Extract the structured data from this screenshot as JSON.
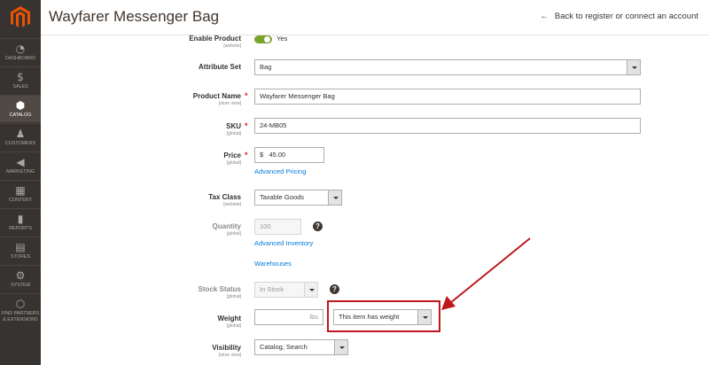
{
  "header": {
    "title": "Wayfarer Messenger Bag",
    "back_label": "Back to register or connect an account"
  },
  "sidebar": {
    "items": [
      {
        "icon": "dashboard-icon",
        "label": "DASHBOARD"
      },
      {
        "icon": "dollar-icon",
        "label": "SALES"
      },
      {
        "icon": "catalog-box-icon",
        "label": "CATALOG"
      },
      {
        "icon": "person-icon",
        "label": "CUSTOMERS"
      },
      {
        "icon": "megaphone-icon",
        "label": "MARKETING"
      },
      {
        "icon": "content-grid-icon",
        "label": "CONTENT"
      },
      {
        "icon": "bar-chart-icon",
        "label": "REPORTS"
      },
      {
        "icon": "store-icon",
        "label": "STORES"
      },
      {
        "icon": "gear-icon",
        "label": "SYSTEM"
      },
      {
        "icon": "extensions-icon",
        "label": "FIND PARTNERS & EXTENSIONS"
      }
    ]
  },
  "form": {
    "enable_product": {
      "label": "Enable Product",
      "scope": "[website]",
      "value": "Yes",
      "on": true
    },
    "attribute_set": {
      "label": "Attribute Set",
      "value": "Bag"
    },
    "product_name": {
      "label": "Product Name",
      "scope": "[store view]",
      "value": "Wayfarer Messenger Bag"
    },
    "sku": {
      "label": "SKU",
      "scope": "[global]",
      "value": "24-MB05"
    },
    "price": {
      "label": "Price",
      "scope": "[global]",
      "currency": "$",
      "value": "45.00",
      "advanced_link": "Advanced Pricing"
    },
    "tax_class": {
      "label": "Tax Class",
      "scope": "[website]",
      "value": "Taxable Goods"
    },
    "quantity": {
      "label": "Quantity",
      "scope": "[global]",
      "value": "100",
      "advanced_link": "Advanced Inventory",
      "warehouses_link": "Warehouses"
    },
    "stock_status": {
      "label": "Stock Status",
      "scope": "[global]",
      "value": "In Stock"
    },
    "weight": {
      "label": "Weight",
      "scope": "[global]",
      "unit": "lbs",
      "value": "",
      "has_weight": "This item has weight"
    },
    "visibility": {
      "label": "Visibility",
      "scope": "[store view]",
      "value": "Catalog, Search"
    }
  },
  "colors": {
    "accent": "#eb5202",
    "sidebar_bg": "#373330",
    "link": "#007bdb",
    "required": "#e22626",
    "annotation": "#c0171d"
  }
}
